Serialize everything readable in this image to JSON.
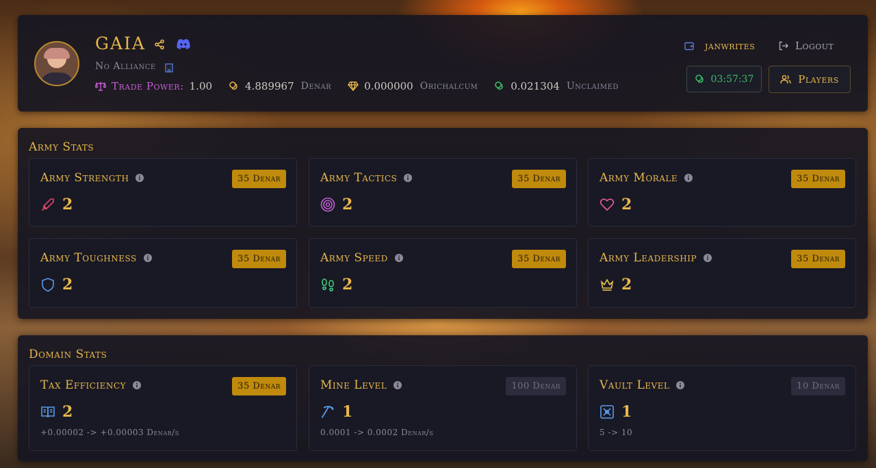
{
  "player": {
    "name": "GAIA",
    "alliance": "No Alliance",
    "trade_power_label": "Trade Power:",
    "trade_power_value": "1.00",
    "denar_value": "4.889967",
    "denar_unit": "Denar",
    "orichalcum_value": "0.000000",
    "orichalcum_unit": "Orichalcum",
    "unclaimed_value": "0.021304",
    "unclaimed_unit": "Unclaimed"
  },
  "nav": {
    "wallet_label": "janwrites",
    "logout_label": "Logout",
    "timer": "03:57:37",
    "players_label": "Players"
  },
  "army": {
    "title": "Army Stats",
    "cards": [
      {
        "title": "Army Strength",
        "cost": "35 Denar",
        "value": "2",
        "icon": "sword-icon"
      },
      {
        "title": "Army Tactics",
        "cost": "35 Denar",
        "value": "2",
        "icon": "target-icon"
      },
      {
        "title": "Army Morale",
        "cost": "35 Denar",
        "value": "2",
        "icon": "heart-icon"
      },
      {
        "title": "Army Toughness",
        "cost": "35 Denar",
        "value": "2",
        "icon": "shield-icon"
      },
      {
        "title": "Army Speed",
        "cost": "35 Denar",
        "value": "2",
        "icon": "footprints-icon"
      },
      {
        "title": "Army Leadership",
        "cost": "35 Denar",
        "value": "2",
        "icon": "crown-icon"
      }
    ]
  },
  "domain": {
    "title": "Domain Stats",
    "cards": [
      {
        "title": "Tax Efficiency",
        "cost": "35 Denar",
        "value": "2",
        "desc": "+0.00002 -> +0.00003 Denar/s",
        "icon": "book-icon"
      },
      {
        "title": "Mine Level",
        "cost": "100 Denar",
        "value": "1",
        "desc": "0.0001 -> 0.0002 Denar/s",
        "icon": "pickaxe-icon"
      },
      {
        "title": "Vault Level",
        "cost": "10 Denar",
        "value": "1",
        "desc": "5 -> 10",
        "icon": "vault-icon"
      }
    ]
  },
  "colors": {
    "gold": "#e8b84a",
    "badge_active": "#c08a0c",
    "badge_disabled": "#2c2c3c",
    "trade_power": "#c45fd6",
    "timer_green": "#3fbf6a",
    "discord": "#5865f2"
  }
}
